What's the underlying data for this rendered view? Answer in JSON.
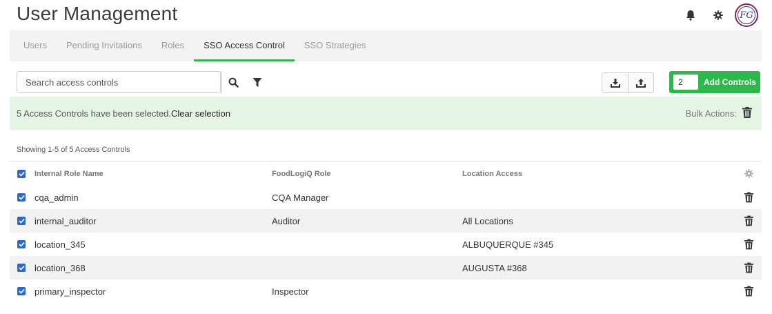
{
  "header": {
    "title": "User Management",
    "icons": [
      "bell-icon",
      "gear-icon"
    ],
    "avatar_text": "FG"
  },
  "tabs": [
    {
      "label": "Users",
      "active": false
    },
    {
      "label": "Pending Invitations",
      "active": false
    },
    {
      "label": "Roles",
      "active": false
    },
    {
      "label": "SSO Access Control",
      "active": true
    },
    {
      "label": "SSO Strategies",
      "active": false
    }
  ],
  "toolbar": {
    "search_placeholder": "Search access controls",
    "add_quantity": "2",
    "add_label": "Add Controls"
  },
  "selection": {
    "message": "5 Access Controls have been selected.",
    "clear_label": "Clear selection",
    "bulk_label": "Bulk Actions:"
  },
  "table": {
    "showing": "Showing 1-5 of 5 Access Controls",
    "headers": {
      "internal_role": "Internal Role Name",
      "foodlogiq_role": "FoodLogiQ Role",
      "location_access": "Location Access"
    },
    "rows": [
      {
        "internal_role": "cqa_admin",
        "foodlogiq_role": "CQA Manager",
        "location_access": "",
        "checked": true
      },
      {
        "internal_role": "internal_auditor",
        "foodlogiq_role": "Auditor",
        "location_access": "All Locations",
        "checked": true
      },
      {
        "internal_role": "location_345",
        "foodlogiq_role": "",
        "location_access": "ALBUQUERQUE #345",
        "checked": true
      },
      {
        "internal_role": "location_368",
        "foodlogiq_role": "",
        "location_access": "AUGUSTA #368",
        "checked": true
      },
      {
        "internal_role": "primary_inspector",
        "foodlogiq_role": "Inspector",
        "location_access": "",
        "checked": true
      }
    ]
  },
  "colors": {
    "accent_green": "#2eb84b",
    "banner_green": "#e4f5e4",
    "checkbox_blue": "#2966d6"
  }
}
